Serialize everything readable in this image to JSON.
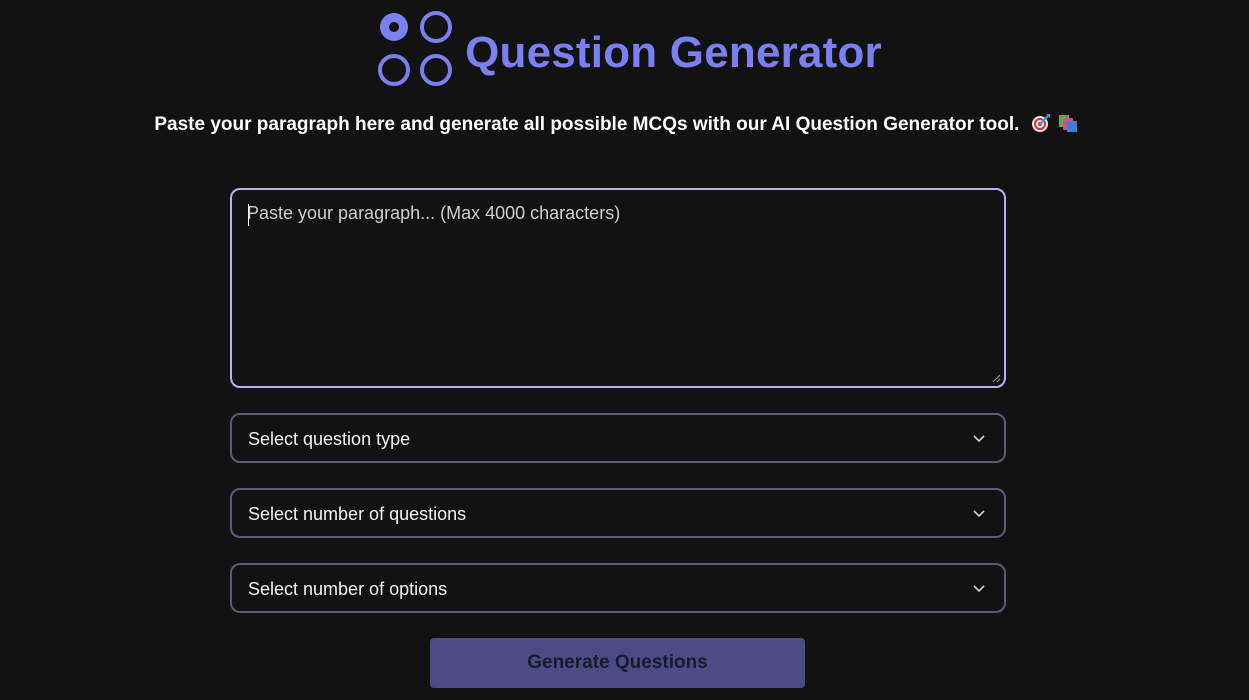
{
  "header": {
    "title": "Question Generator",
    "logo_icon": "four-circles-logo-icon",
    "accent_color": "#7b7ff0"
  },
  "subtitle": {
    "text": "Paste your paragraph here and generate all possible MCQs with our AI Question Generator tool.",
    "emojis": [
      "target-icon",
      "books-icon"
    ]
  },
  "form": {
    "paragraph_placeholder": "Paste your paragraph... (Max 4000 characters)",
    "paragraph_value": "",
    "question_type": {
      "label": "Select question type",
      "icon": "chevron-down-icon"
    },
    "num_questions": {
      "label": "Select number of questions",
      "icon": "chevron-down-icon"
    },
    "num_options": {
      "label": "Select number of options",
      "icon": "chevron-down-icon"
    },
    "submit_label": "Generate Questions"
  },
  "colors": {
    "background": "#121213",
    "textarea_border": "#b8b0f0",
    "select_border": "#5c5a78",
    "button_bg": "#4b4c86"
  }
}
